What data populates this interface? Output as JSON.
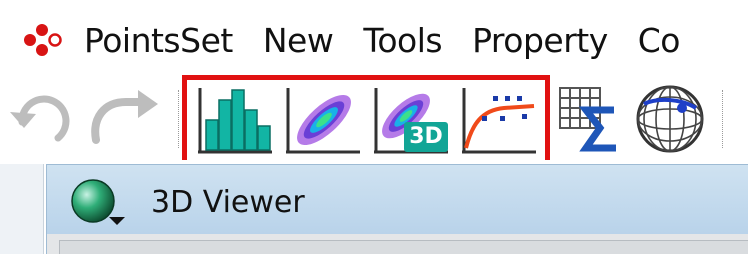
{
  "menubar": {
    "app_icon": "points-scatter-icon",
    "items": [
      {
        "label": "PointsSet"
      },
      {
        "label": "New"
      },
      {
        "label": "Tools"
      },
      {
        "label": "Property"
      },
      {
        "label": "Co"
      }
    ]
  },
  "toolbar": {
    "buttons": [
      {
        "icon": "undo-icon"
      },
      {
        "icon": "redo-icon"
      },
      {
        "icon": "histogram-icon"
      },
      {
        "icon": "density-2d-icon"
      },
      {
        "icon": "density-3d-icon",
        "badge": "3D"
      },
      {
        "icon": "curve-fit-icon"
      },
      {
        "icon": "grid-sum-icon"
      },
      {
        "icon": "globe-icon"
      }
    ],
    "highlight_color": "#e11111"
  },
  "viewer": {
    "icon": "sphere-dropdown-icon",
    "title": "3D Viewer"
  },
  "colors": {
    "teal": "#12b5a4",
    "teal_dark": "#0b6e63",
    "title_bar": "#c5dcef",
    "highlight": "#e11111"
  }
}
